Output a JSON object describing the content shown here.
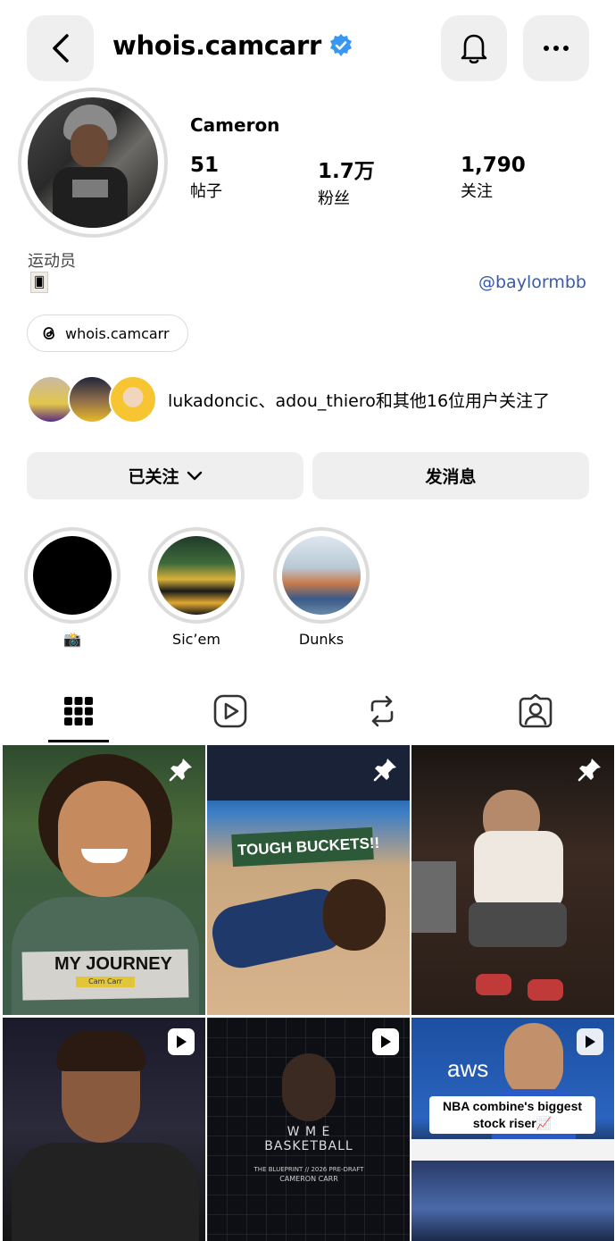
{
  "header": {
    "username": "whois.camcarr",
    "back_icon": "chevron-left-icon",
    "bell_icon": "bell-icon",
    "more_icon": "more-horizontal-icon"
  },
  "profile": {
    "display_name": "Cameron",
    "stats": [
      {
        "value": "51",
        "label": "帖子"
      },
      {
        "value": "1.7万",
        "label": "粉丝"
      },
      {
        "value": "1,790",
        "label": "关注"
      }
    ],
    "bio_line": "运动员",
    "mention": "@baylormbb",
    "threads_handle": "whois.camcarr",
    "followed_by_text": "lukadoncic、adou_thiero和其他16位用户关注了"
  },
  "buttons": {
    "following_label": "已关注",
    "message_label": "发消息"
  },
  "highlights": [
    {
      "label": "📸"
    },
    {
      "label": "Sic’em"
    },
    {
      "label": "Dunks"
    }
  ],
  "grid": {
    "posts": [
      {
        "banner": "MY JOURNEY",
        "sub": "Cam Carr",
        "badge": "pin-icon"
      },
      {
        "banner": "TOUGH BUCKETS!!",
        "badge": "pin-icon"
      },
      {
        "banner": "",
        "badge": "pin-icon"
      },
      {
        "banner": "",
        "badge": "reel-icon"
      },
      {
        "banner": "W M E BASKETBALL",
        "sub": "THE BLUEPRINT // 2026 PRE-DRAFT",
        "sub2": "CAMERON CARR",
        "badge": "reel-icon"
      },
      {
        "banner": "NBA combine's biggest stock riser📈",
        "badge": "reel-icon"
      }
    ]
  },
  "colors": {
    "accent_blue": "#3a5aa8",
    "verified": "#3897f0",
    "button_bg": "#efefef"
  }
}
